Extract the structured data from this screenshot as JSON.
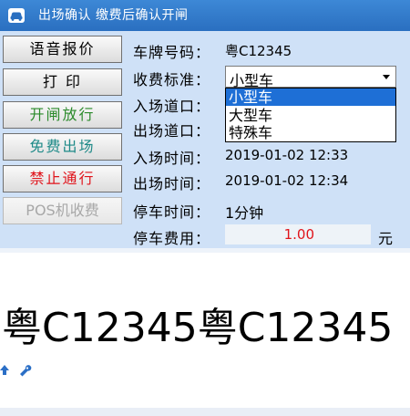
{
  "window": {
    "title": "出场确认  缴费后确认开闸"
  },
  "buttons": {
    "voice_price": {
      "label": "语音报价",
      "color": "#000000"
    },
    "print": {
      "label": "打 印",
      "color": "#000000"
    },
    "open_gate": {
      "label": "开闸放行",
      "color": "#2b8a2b"
    },
    "free_exit": {
      "label": "免费出场",
      "color": "#1f8a88"
    },
    "no_passage": {
      "label": "禁止通行",
      "color": "#e0131a"
    },
    "pos_charge": {
      "label": "POS机收费",
      "color": "#a8a8a8"
    }
  },
  "form": {
    "plate_label": "车牌号码：",
    "plate_value": "粤C12345",
    "fee_standard_label": "收费标准：",
    "fee_standard_selected": "小型车",
    "fee_standard_options": [
      "小型车",
      "大型车",
      "特殊车"
    ],
    "entry_lane_label": "入场道口：",
    "exit_lane_label": "出场道口：",
    "entry_time_label": "入场时间：",
    "entry_time_value": "2019-01-02 12:33",
    "exit_time_label": "出场时间：",
    "exit_time_value": "2019-01-02 12:34",
    "duration_label": "停车时间：",
    "duration_value": "1分钟",
    "fee_label": "停车费用：",
    "fee_value": "1.00",
    "fee_unit": "元"
  },
  "plate_display": "粤C12345粤C12345",
  "icons": [
    "car-icon",
    "up-arrow-icon",
    "wrench-icon"
  ]
}
